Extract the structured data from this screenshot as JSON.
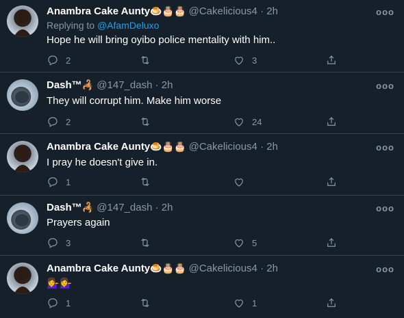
{
  "tweets": [
    {
      "name": "Anambra Cake Aunty",
      "emojis": "🍮🎂🎂",
      "handle": "@Cakelicious4",
      "time": "2h",
      "replying_label": "Replying to ",
      "replying_to": "@AfamDeluxo",
      "text": "Hope he will bring oyibo police mentality with him..",
      "replies": "2",
      "retweets": "",
      "likes": "3"
    },
    {
      "name": "Dash™",
      "emojis": "🦂",
      "handle": "@147_dash",
      "time": "2h",
      "text": "They will corrupt him. Make him worse",
      "replies": "2",
      "retweets": "",
      "likes": "24"
    },
    {
      "name": "Anambra Cake Aunty",
      "emojis": "🍮🎂🎂",
      "handle": "@Cakelicious4",
      "time": "2h",
      "text": "I pray he doesn't give in.",
      "replies": "1",
      "retweets": "",
      "likes": ""
    },
    {
      "name": "Dash™",
      "emojis": "🦂",
      "handle": "@147_dash",
      "time": "2h",
      "text": "Prayers again",
      "replies": "3",
      "retweets": "",
      "likes": "5"
    },
    {
      "name": "Anambra Cake Aunty",
      "emojis": "🍮🎂🎂",
      "handle": "@Cakelicious4",
      "time": "2h",
      "text": "💁‍♀️💁‍♀️",
      "replies": "1",
      "retweets": "",
      "likes": "1"
    }
  ],
  "separator": "·",
  "more_glyph": "ooo",
  "colors": {
    "background": "#15202b",
    "muted": "#8899a6",
    "link": "#1da1f2",
    "border": "#38444d"
  },
  "icons": [
    "reply-icon",
    "retweet-icon",
    "like-icon",
    "share-icon",
    "more-icon"
  ]
}
